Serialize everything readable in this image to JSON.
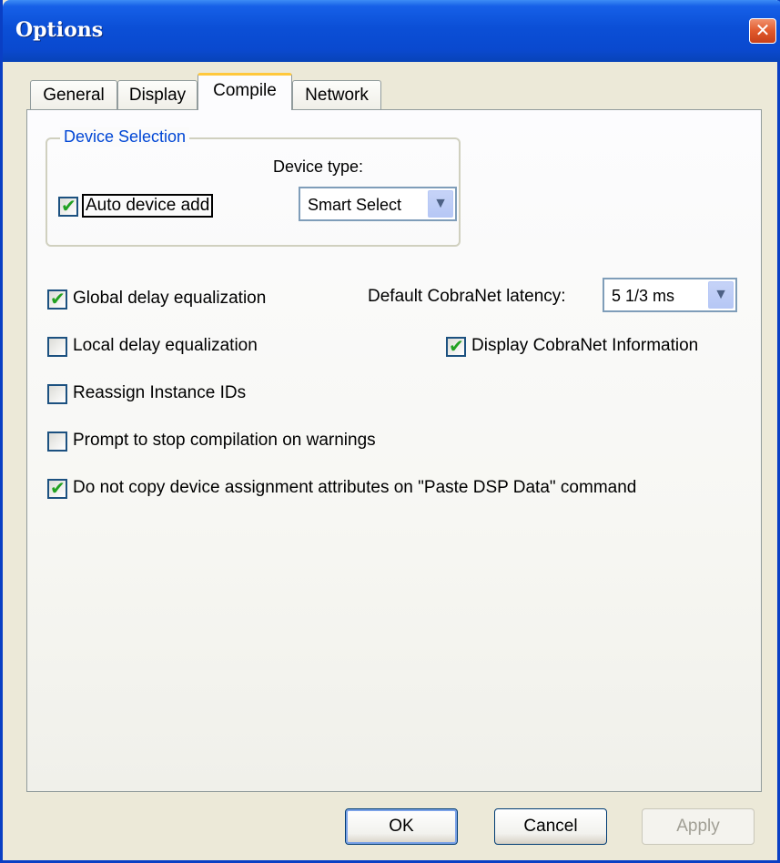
{
  "window": {
    "title": "Options",
    "close_glyph": "✕"
  },
  "tabs": [
    "General",
    "Display",
    "Compile",
    "Network"
  ],
  "active_tab": "Compile",
  "device_selection": {
    "group_label": "Device Selection",
    "auto_device_add": {
      "label": "Auto device add",
      "checked": true
    },
    "device_type_label": "Device type:",
    "device_type_value": "Smart Select"
  },
  "options": {
    "global_delay": {
      "label": "Global delay equalization",
      "checked": true
    },
    "latency_label": "Default CobraNet latency:",
    "latency_value": "5 1/3 ms",
    "local_delay": {
      "label": "Local delay equalization",
      "checked": false
    },
    "display_cobranet": {
      "label": "Display CobraNet Information",
      "checked": true
    },
    "reassign_ids": {
      "label": "Reassign Instance IDs",
      "checked": false
    },
    "prompt_stop": {
      "label": "Prompt to stop compilation on warnings",
      "checked": false
    },
    "no_copy_attrs": {
      "label": "Do not copy device assignment attributes on \"Paste DSP Data\" command",
      "checked": true
    }
  },
  "buttons": {
    "ok": "OK",
    "cancel": "Cancel",
    "apply": "Apply"
  },
  "icons": {
    "check": "✔",
    "dropdown": "▼"
  }
}
